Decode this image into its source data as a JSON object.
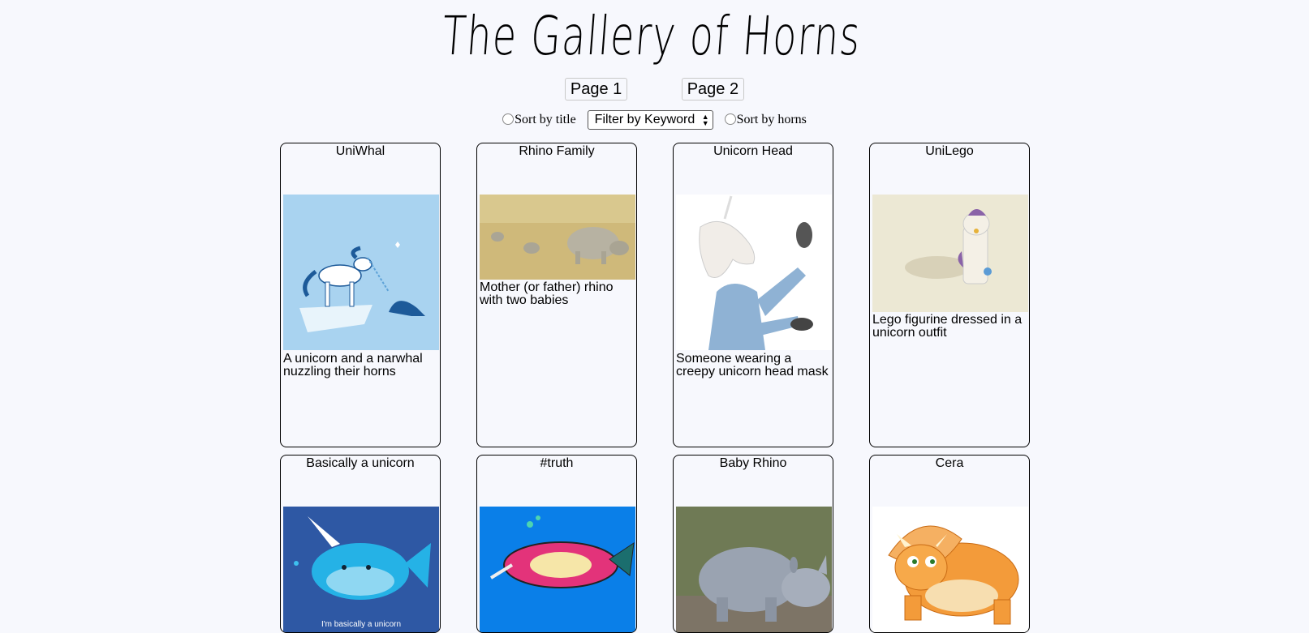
{
  "header": {
    "title": "The Gallery of Horns"
  },
  "pagination": {
    "page1": "Page 1",
    "page2": "Page 2"
  },
  "controls": {
    "sort_title": "Sort by title",
    "filter_selected": "Filter by Keyword",
    "sort_horns": "Sort by horns"
  },
  "cards": [
    {
      "title": "UniWhal",
      "description": "A unicorn and a narwhal nuzzling their horns",
      "icon": "unicorn-narwhal-image"
    },
    {
      "title": "Rhino Family",
      "description": "Mother (or father) rhino with two babies",
      "icon": "rhino-family-image"
    },
    {
      "title": "Unicorn Head",
      "description": "Someone wearing a creepy unicorn head mask",
      "icon": "unicorn-mask-image"
    },
    {
      "title": "UniLego",
      "description": "Lego figurine dressed in a unicorn outfit",
      "icon": "lego-unicorn-image"
    },
    {
      "title": "Basically a unicorn",
      "description": "",
      "icon": "narwhal-cartoon-image",
      "caption": "I'm basically a unicorn"
    },
    {
      "title": "#truth",
      "description": "",
      "icon": "narwhal-unicorn-image"
    },
    {
      "title": "Baby Rhino",
      "description": "",
      "icon": "baby-rhino-image"
    },
    {
      "title": "Cera",
      "description": "",
      "icon": "triceratops-image"
    }
  ]
}
